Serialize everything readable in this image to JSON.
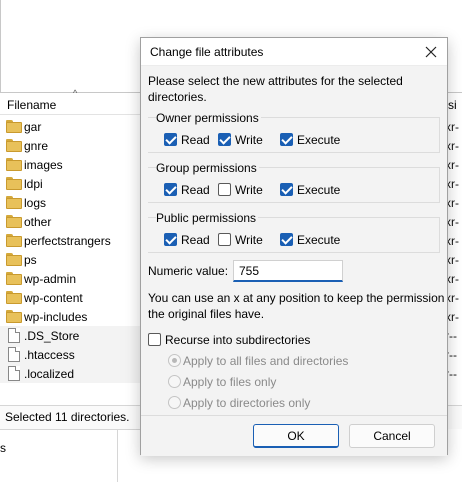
{
  "file_list": {
    "column_filename": "Filename",
    "column_permissions_partial": "ssi",
    "sort_indicator": "^",
    "files": [
      {
        "name": "gar",
        "type": "folder",
        "perm": "xr-"
      },
      {
        "name": "gnre",
        "type": "folder",
        "perm": "xr-"
      },
      {
        "name": "images",
        "type": "folder",
        "perm": "xr-"
      },
      {
        "name": "ldpi",
        "type": "folder",
        "perm": "xr-"
      },
      {
        "name": "logs",
        "type": "folder",
        "perm": "xr-"
      },
      {
        "name": "other",
        "type": "folder",
        "perm": "xr-"
      },
      {
        "name": "perfectstrangers",
        "type": "folder",
        "perm": "xr-"
      },
      {
        "name": "ps",
        "type": "folder",
        "perm": "xr-"
      },
      {
        "name": "wp-admin",
        "type": "folder",
        "perm": "xr-"
      },
      {
        "name": "wp-content",
        "type": "folder",
        "perm": "xr-"
      },
      {
        "name": "wp-includes",
        "type": "folder",
        "perm": "xr-"
      },
      {
        "name": ".DS_Store",
        "type": "file",
        "perm": "r--"
      },
      {
        "name": ".htaccess",
        "type": "file",
        "perm": "r--"
      },
      {
        "name": ".localized",
        "type": "file",
        "perm": "r--"
      }
    ],
    "status": "Selected 11 directories.",
    "bottom_partial": "s"
  },
  "dialog": {
    "title": "Change file attributes",
    "intro": "Please select the new attributes for the selected directories.",
    "groups": [
      {
        "title": "Owner permissions",
        "read": true,
        "write": true,
        "execute": true
      },
      {
        "title": "Group permissions",
        "read": true,
        "write": false,
        "execute": true
      },
      {
        "title": "Public permissions",
        "read": true,
        "write": false,
        "execute": true
      }
    ],
    "labels": {
      "read": "Read",
      "write": "Write",
      "execute": "Execute"
    },
    "numeric_label": "Numeric value:",
    "numeric_value": "755",
    "hint": "You can use an x at any position to keep the permission the original files have.",
    "recurse_label": "Recurse into subdirectories",
    "recurse_checked": false,
    "radio_options": [
      {
        "label": "Apply to all files and directories",
        "selected": true
      },
      {
        "label": "Apply to files only",
        "selected": false
      },
      {
        "label": "Apply to directories only",
        "selected": false
      }
    ],
    "ok_label": "OK",
    "cancel_label": "Cancel"
  },
  "colors": {
    "accent": "#1a5fb4",
    "folder": "#e8c15a"
  }
}
